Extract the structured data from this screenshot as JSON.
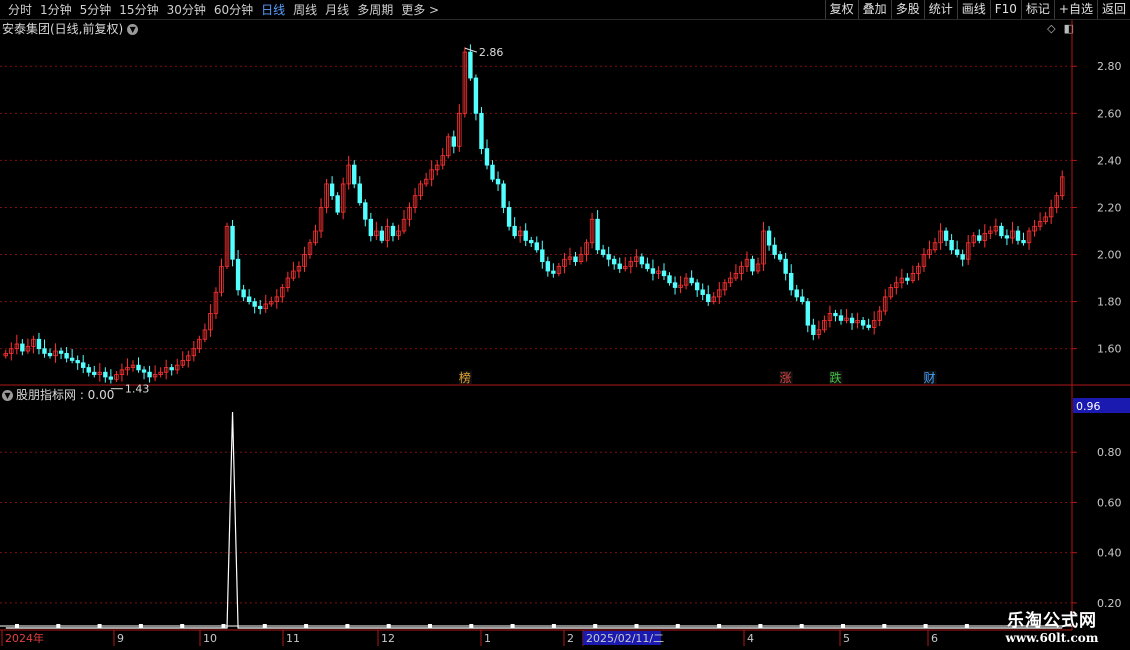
{
  "toolbar": {
    "periods": [
      "分时",
      "1分钟",
      "5分钟",
      "15分钟",
      "30分钟",
      "60分钟",
      "日线",
      "周线",
      "月线",
      "多周期",
      "更多 >"
    ],
    "active_period": "日线",
    "buttons": [
      "复权",
      "叠加",
      "多股",
      "统计",
      "画线",
      "F10",
      "标记",
      "+自选",
      "返回"
    ]
  },
  "main": {
    "title": "安泰集团(日线,前复权)",
    "high_label": "2.86",
    "low_label": "1.43",
    "markers": [
      {
        "text": "榜",
        "color": "#e0a030"
      },
      {
        "text": "涨",
        "color": "#e04040"
      },
      {
        "text": "跌",
        "color": "#40c040"
      },
      {
        "text": "财",
        "color": "#40a0ff"
      }
    ]
  },
  "indicator": {
    "title": "股朋指标网 : 0.00",
    "current_value_badge": "0.96"
  },
  "xaxis": {
    "labels": [
      "2024年",
      "9",
      "10",
      "11",
      "12",
      "1",
      "2",
      "2025/02/11/二",
      "4",
      "5",
      "6"
    ]
  },
  "watermark": {
    "line1": "乐淘公式网",
    "line2": "www.60lt.com"
  },
  "colors": {
    "up": "#ff3232",
    "down": "#54ffff",
    "grid": "#7a1010",
    "axis": "#b01818",
    "text": "#c8c8c8",
    "badge": "#1a1ab0"
  },
  "chart_data": [
    {
      "type": "candlestick",
      "title": "安泰集团(日线,前复权)",
      "ylim": [
        1.45,
        2.92
      ],
      "yticks": [
        1.6,
        1.8,
        2.0,
        2.2,
        2.4,
        2.6,
        2.8
      ],
      "ytick_labels": [
        "1.60",
        "1.80",
        "2.00",
        "2.20",
        "2.40",
        "2.60",
        "2.80"
      ],
      "annotations": [
        {
          "text": "2.86",
          "value": 2.86
        },
        {
          "text": "1.43",
          "value": 1.43
        }
      ],
      "closes": [
        1.58,
        1.6,
        1.62,
        1.59,
        1.61,
        1.64,
        1.6,
        1.58,
        1.57,
        1.59,
        1.58,
        1.56,
        1.55,
        1.54,
        1.52,
        1.5,
        1.49,
        1.5,
        1.48,
        1.47,
        1.49,
        1.51,
        1.52,
        1.53,
        1.51,
        1.5,
        1.48,
        1.49,
        1.5,
        1.52,
        1.51,
        1.53,
        1.55,
        1.57,
        1.6,
        1.64,
        1.68,
        1.75,
        1.84,
        1.95,
        2.12,
        1.98,
        1.85,
        1.82,
        1.8,
        1.78,
        1.77,
        1.79,
        1.8,
        1.82,
        1.86,
        1.9,
        1.93,
        1.95,
        2.0,
        2.05,
        2.1,
        2.2,
        2.3,
        2.25,
        2.18,
        2.3,
        2.38,
        2.3,
        2.22,
        2.15,
        2.08,
        2.1,
        2.06,
        2.12,
        2.08,
        2.1,
        2.15,
        2.2,
        2.25,
        2.3,
        2.32,
        2.36,
        2.38,
        2.42,
        2.5,
        2.46,
        2.6,
        2.86,
        2.75,
        2.6,
        2.45,
        2.38,
        2.32,
        2.3,
        2.2,
        2.12,
        2.08,
        2.1,
        2.06,
        2.05,
        2.02,
        1.97,
        1.93,
        1.92,
        1.95,
        1.98,
        1.99,
        1.97,
        2.0,
        2.05,
        2.15,
        2.02,
        2.0,
        1.98,
        1.96,
        1.94,
        1.95,
        1.97,
        1.99,
        1.96,
        1.94,
        1.92,
        1.93,
        1.91,
        1.88,
        1.86,
        1.87,
        1.9,
        1.88,
        1.85,
        1.83,
        1.8,
        1.82,
        1.85,
        1.88,
        1.9,
        1.92,
        1.95,
        1.98,
        1.93,
        1.96,
        2.1,
        2.04,
        2.0,
        1.98,
        1.92,
        1.85,
        1.82,
        1.8,
        1.7,
        1.66,
        1.68,
        1.72,
        1.75,
        1.74,
        1.72,
        1.73,
        1.71,
        1.72,
        1.7,
        1.69,
        1.72,
        1.76,
        1.82,
        1.86,
        1.88,
        1.9,
        1.89,
        1.92,
        1.95,
        2.0,
        2.02,
        2.05,
        2.1,
        2.06,
        2.02,
        2.0,
        1.98,
        2.05,
        2.08,
        2.06,
        2.09,
        2.1,
        2.12,
        2.08,
        2.07,
        2.1,
        2.06,
        2.05,
        2.1,
        2.12,
        2.14,
        2.16,
        2.2,
        2.25,
        2.33
      ]
    },
    {
      "type": "line",
      "title": "股朋指标网 : 0.00",
      "ylim": [
        0.1,
        1.0
      ],
      "yticks": [
        0.2,
        0.4,
        0.6,
        0.8
      ],
      "ytick_labels": [
        "0.20",
        "0.40",
        "0.60",
        "0.80"
      ],
      "spike_index": 41,
      "spike_value": 0.96,
      "baseline": 0.0,
      "marker_count": 24
    }
  ]
}
